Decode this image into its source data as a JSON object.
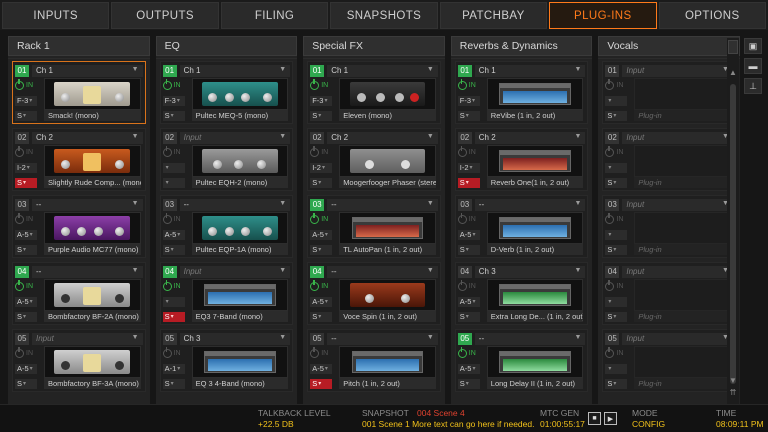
{
  "tabs": [
    "INPUTS",
    "OUTPUTS",
    "FILING",
    "SNAPSHOTS",
    "PATCHBAY",
    "PLUG-INS",
    "OPTIONS"
  ],
  "active_tab": "PLUG-INS",
  "columns": [
    {
      "title": "Rack 1",
      "slots": [
        {
          "num": "01",
          "green": true,
          "source": "Ch 1",
          "on": true,
          "io": "F-3",
          "mode": "S",
          "mode_red": false,
          "plugin": "Smack! (mono)",
          "selected": true,
          "face": "amp"
        },
        {
          "num": "02",
          "green": false,
          "source": "Ch 2",
          "on": false,
          "io": "I-2",
          "mode": "S",
          "mode_red": true,
          "plugin": "Slightly Rude Comp... (mono)",
          "face": "orange"
        },
        {
          "num": "03",
          "green": false,
          "source": "--",
          "on": false,
          "io": "A-5",
          "mode": "S",
          "mode_red": false,
          "plugin": "Purple Audio MC77 (mono)",
          "face": "purple"
        },
        {
          "num": "04",
          "green": true,
          "source": "--",
          "on": true,
          "io": "A-5",
          "mode": "S",
          "mode_red": false,
          "plugin": "Bombfactory BF-2A (mono)",
          "face": "silver"
        },
        {
          "num": "05",
          "green": false,
          "source": "Input",
          "source_dim": true,
          "on": false,
          "io": "A-5",
          "mode": "S",
          "mode_red": false,
          "plugin": "Bombfactory BF-3A (mono)",
          "face": "silver"
        }
      ]
    },
    {
      "title": "EQ",
      "slots": [
        {
          "num": "01",
          "green": true,
          "source": "Ch 1",
          "on": true,
          "io": "F-3",
          "mode": "S",
          "mode_red": false,
          "plugin": "Pultec MEQ-5 (mono)",
          "face": "teal"
        },
        {
          "num": "02",
          "green": false,
          "source": "Input",
          "source_dim": true,
          "on": false,
          "io": "",
          "mode": "",
          "mode_red": false,
          "plugin": "Pultec EQH-2 (mono)",
          "face": "grey"
        },
        {
          "num": "03",
          "green": false,
          "source": "--",
          "on": false,
          "io": "A-5",
          "mode": "S",
          "mode_red": false,
          "plugin": "Pultec EQP-1A (mono)",
          "face": "teal"
        },
        {
          "num": "04",
          "green": true,
          "source": "Input",
          "source_dim": true,
          "on": true,
          "io": "",
          "mode": "S",
          "mode_red": true,
          "plugin": "EQ3 7-Band (mono)",
          "face": "win"
        },
        {
          "num": "05",
          "green": false,
          "source": "Ch 3",
          "on": false,
          "io": "A-1",
          "mode": "S",
          "mode_red": false,
          "plugin": "EQ 3 4-Band (mono)",
          "face": "win"
        }
      ]
    },
    {
      "title": "Special FX",
      "slots": [
        {
          "num": "01",
          "green": true,
          "source": "Ch 1",
          "on": true,
          "io": "F-3",
          "mode": "S",
          "mode_red": false,
          "plugin": "Eleven (mono)",
          "face": "dark"
        },
        {
          "num": "02",
          "green": false,
          "source": "Ch 2",
          "on": false,
          "io": "I-2",
          "mode": "S",
          "mode_red": false,
          "plugin": "Moogerfooger Phaser (stereo)",
          "face": "greyplug"
        },
        {
          "num": "03",
          "green": true,
          "source": "--",
          "on": true,
          "io": "A-5",
          "mode": "S",
          "mode_red": false,
          "plugin": "TL AutoPan (1 in, 2 out)",
          "face": "redwin"
        },
        {
          "num": "04",
          "green": true,
          "source": "--",
          "on": true,
          "io": "A-5",
          "mode": "S",
          "mode_red": false,
          "plugin": "Voce Spin (1 in, 2 out)",
          "face": "wood"
        },
        {
          "num": "05",
          "green": false,
          "source": "--",
          "on": false,
          "io": "A-5",
          "mode": "S",
          "mode_red": true,
          "plugin": "Pitch (1 in, 2 out)",
          "face": "win"
        }
      ]
    },
    {
      "title": "Reverbs & Dynamics",
      "slots": [
        {
          "num": "01",
          "green": true,
          "source": "Ch 1",
          "on": true,
          "io": "F-3",
          "mode": "S",
          "mode_red": false,
          "plugin": "ReVibe (1 in, 2 out)",
          "face": "win"
        },
        {
          "num": "02",
          "green": false,
          "source": "Ch 2",
          "on": false,
          "io": "I-2",
          "mode": "S",
          "mode_red": true,
          "plugin": "Reverb One(1 in, 2 out)",
          "face": "winred"
        },
        {
          "num": "03",
          "green": false,
          "source": "--",
          "on": false,
          "io": "A-5",
          "mode": "S",
          "mode_red": false,
          "plugin": "D-Verb (1 in, 2 out)",
          "face": "win"
        },
        {
          "num": "04",
          "green": false,
          "source": "Ch 3",
          "on": false,
          "io": "A-5",
          "mode": "S",
          "mode_red": false,
          "plugin": "Extra Long De... (1 in, 2 out)",
          "face": "wingreen"
        },
        {
          "num": "05",
          "green": true,
          "source": "--",
          "on": true,
          "io": "A-5",
          "mode": "S",
          "mode_red": false,
          "plugin": "Long Delay II (1 in, 2 out)",
          "face": "wingreen"
        }
      ]
    },
    {
      "title": "Vocals",
      "slots": [
        {
          "num": "01",
          "green": false,
          "source": "Input",
          "source_dim": true,
          "on": false,
          "io": "",
          "mode": "S",
          "mode_red": false,
          "plugin": "Plug-in",
          "plugin_dim": true,
          "face": "empty"
        },
        {
          "num": "02",
          "green": false,
          "source": "Input",
          "source_dim": true,
          "on": false,
          "io": "",
          "mode": "S",
          "mode_red": false,
          "plugin": "Plug-in",
          "plugin_dim": true,
          "face": "empty"
        },
        {
          "num": "03",
          "green": false,
          "source": "Input",
          "source_dim": true,
          "on": false,
          "io": "",
          "mode": "S",
          "mode_red": false,
          "plugin": "Plug-in",
          "plugin_dim": true,
          "face": "empty"
        },
        {
          "num": "04",
          "green": false,
          "source": "Input",
          "source_dim": true,
          "on": false,
          "io": "",
          "mode": "S",
          "mode_red": false,
          "plugin": "Plug-in",
          "plugin_dim": true,
          "face": "empty"
        },
        {
          "num": "05",
          "green": false,
          "source": "Input",
          "source_dim": true,
          "on": false,
          "io": "",
          "mode": "S",
          "mode_red": false,
          "plugin": "Plug-in",
          "plugin_dim": true,
          "face": "empty"
        }
      ]
    }
  ],
  "labels": {
    "in": "IN"
  },
  "status": {
    "talkback_label": "TALKBACK LEVEL",
    "talkback_value": "+22.5 DB",
    "snapshot_label": "SNAPSHOT",
    "snapshot_current": "004 Scene 4",
    "snapshot_text": "001 Scene 1 More text can go here if needed.",
    "mtc_label": "MTC GEN",
    "mtc_value": "01:00:55:17",
    "mode_label": "MODE",
    "mode_value": "CONFIG",
    "time_label": "TIME",
    "time_value": "08:09:11 PM"
  },
  "colors": {
    "accent": "#ff7a1a",
    "active_green": "#2fa84f",
    "solo_red": "#b71c24",
    "status_value": "#f2c21b"
  }
}
